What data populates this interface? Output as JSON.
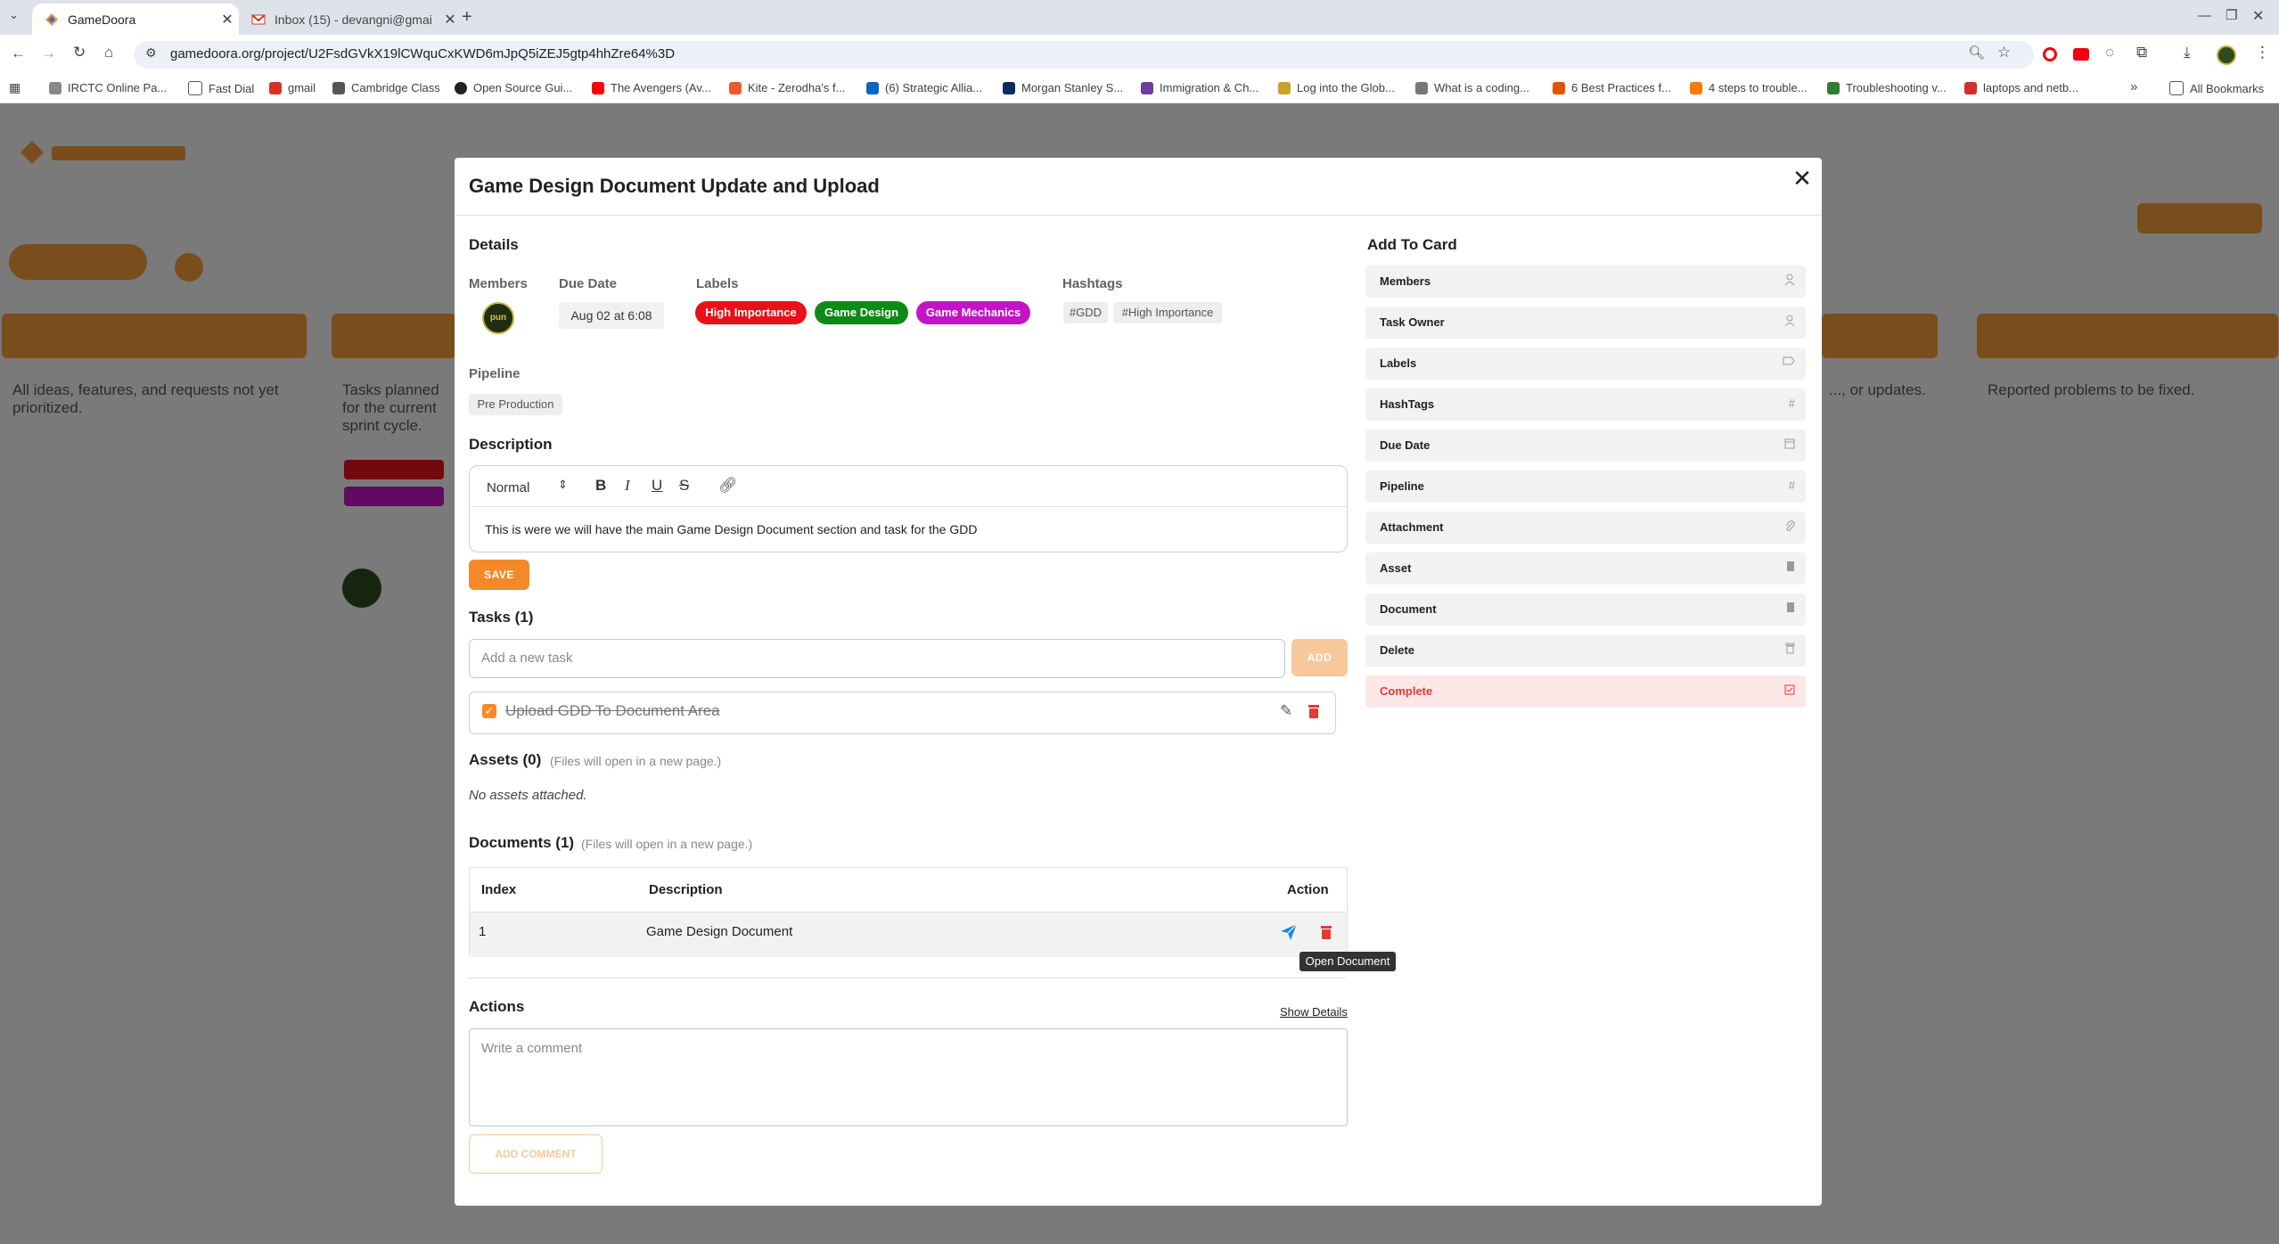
{
  "browser": {
    "tabs": [
      {
        "title": "GameDoora",
        "active": true
      },
      {
        "title": "Inbox (15) - devangni@gmai",
        "active": false
      }
    ],
    "url": "gamedoora.org/project/U2FsdGVkX19lCWquCxKWD6mJpQ5iZEJ5gtp4hhZre64%3D",
    "bookmarks": [
      "IRCTC Online Pa...",
      "Fast Dial",
      "gmail",
      "Cambridge Class",
      "Open Source Gui...",
      "The Avengers (Av...",
      "Kite - Zerodha's f...",
      "(6) Strategic Allia...",
      "Morgan Stanley S...",
      "Immigration & Ch...",
      "Log into the Glob...",
      "What is a coding...",
      "6 Best Practices f...",
      "4 steps to trouble...",
      "Troubleshooting v...",
      "laptops and netb..."
    ],
    "all_bookmarks": "All Bookmarks",
    "more": "»"
  },
  "modal": {
    "title": "Game Design Document Update and Upload",
    "details_heading": "Details",
    "members_label": "Members",
    "member_avatar_text": "pun",
    "due_date_label": "Due Date",
    "due_date": "Aug 02 at 6:08",
    "labels_label": "Labels",
    "labels": [
      {
        "text": "High Importance",
        "color": "#e8101a"
      },
      {
        "text": "Game Design",
        "color": "#0e8a16"
      },
      {
        "text": "Game Mechanics",
        "color": "#c514c5"
      }
    ],
    "hashtags_label": "Hashtags",
    "hashtags": [
      "#GDD",
      "#High Importance"
    ],
    "pipeline_label": "Pipeline",
    "pipeline": "Pre Production",
    "description_heading": "Description",
    "editor_format": "Normal",
    "description_text": "This is were we will have the main Game Design Document section and task for the GDD",
    "save_label": "SAVE",
    "tasks_heading": "Tasks (1)",
    "task_placeholder": "Add a new task",
    "add_label": "ADD",
    "tasks": [
      {
        "text": "Upload GDD To Document Area",
        "done": true
      }
    ],
    "assets_heading": "Assets (0)",
    "assets_note": "(Files will open in a new page.)",
    "no_assets": "No assets attached.",
    "documents_heading": "Documents (1)",
    "documents_note": "(Files will open in a new page.)",
    "doc_columns": {
      "index": "Index",
      "description": "Description",
      "action": "Action"
    },
    "documents": [
      {
        "index": "1",
        "description": "Game Design Document"
      }
    ],
    "tooltip": "Open Document",
    "actions_heading": "Actions",
    "show_details": "Show Details",
    "comment_placeholder": "Write a comment",
    "add_comment_label": "ADD COMMENT"
  },
  "sidebar": {
    "heading": "Add To Card",
    "items": [
      {
        "label": "Members",
        "icon": "person-icon"
      },
      {
        "label": "Task Owner",
        "icon": "person-icon"
      },
      {
        "label": "Labels",
        "icon": "label-icon"
      },
      {
        "label": "HashTags",
        "icon": "hash-icon"
      },
      {
        "label": "Due Date",
        "icon": "calendar-icon"
      },
      {
        "label": "Pipeline",
        "icon": "hash-icon"
      },
      {
        "label": "Attachment",
        "icon": "paperclip-icon"
      },
      {
        "label": "Asset",
        "icon": "file-icon"
      },
      {
        "label": "Document",
        "icon": "file-icon"
      },
      {
        "label": "Delete",
        "icon": "trash-icon"
      },
      {
        "label": "Complete",
        "icon": "check-calendar-icon"
      }
    ]
  },
  "background": {
    "columns": [
      {
        "desc": "All ideas, features, and requests not yet prioritized."
      },
      {
        "desc": "Tasks planned for the current sprint cycle."
      },
      {
        "desc": "..., or updates."
      },
      {
        "desc": "Reported problems to be fixed."
      }
    ]
  },
  "colors": {
    "accent": "#f5892a",
    "complete_bg": "#fde8e8",
    "complete_text": "#e53935",
    "delete_red": "#e53935",
    "send_blue": "#1e88e5"
  }
}
